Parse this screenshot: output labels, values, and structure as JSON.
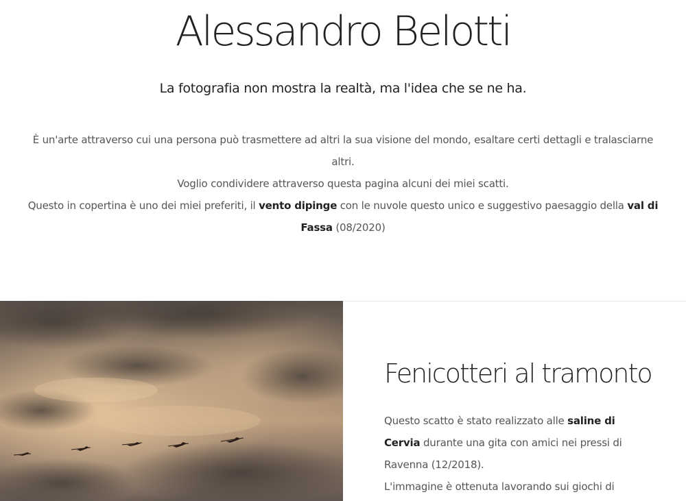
{
  "header": {
    "title": "Alessandro Belotti",
    "tagline": "La fotografia non mostra la realtà, ma l'idea che se ne ha."
  },
  "intro": {
    "line1": "È un'arte attraverso cui una persona può trasmettere ad altri la sua visione del mondo, esaltare certi dettagli e tralasciarne altri.",
    "line2": "Voglio condividere attraverso questa pagina alcuni dei miei scatti.",
    "line3_pre": "Questo in copertina è uno dei miei preferiti, il ",
    "line3_bold1": "vento dipinge",
    "line3_mid": " con le nuvole questo unico e suggestivo paesaggio della ",
    "line3_bold2": "val di Fassa",
    "line3_post": " (08/2020)"
  },
  "feature": {
    "title": "Fenicotteri al tramonto",
    "body_pre": "Questo scatto è stato realizzato alle ",
    "body_bold": "saline di Cervia",
    "body_post": " durante una gita con amici nei pressi di Ravenna (12/2018).",
    "body_line2": "L'immagine è ottenuta lavorando sui giochi di"
  },
  "image": {
    "subject": "flamingos flying at sunset over clouds",
    "sky_dark": "#5d524a",
    "sky_light": "#d9b78f",
    "bird_color": "#2a1d18"
  }
}
